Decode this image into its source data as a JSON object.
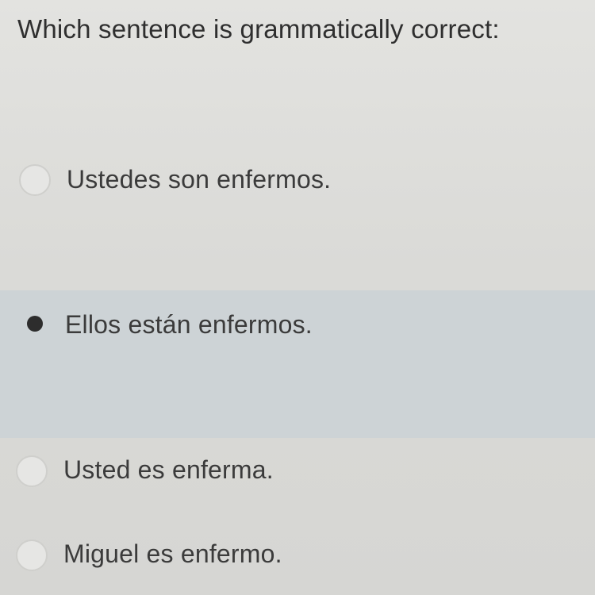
{
  "question": {
    "text": "Which sentence is grammatically correct:"
  },
  "options": [
    {
      "label": "Ustedes son enfermos.",
      "selected": false
    },
    {
      "label": "Ellos están enfermos.",
      "selected": true
    },
    {
      "label": "Usted es enferma.",
      "selected": false
    },
    {
      "label": "Miguel es enfermo.",
      "selected": false
    }
  ]
}
